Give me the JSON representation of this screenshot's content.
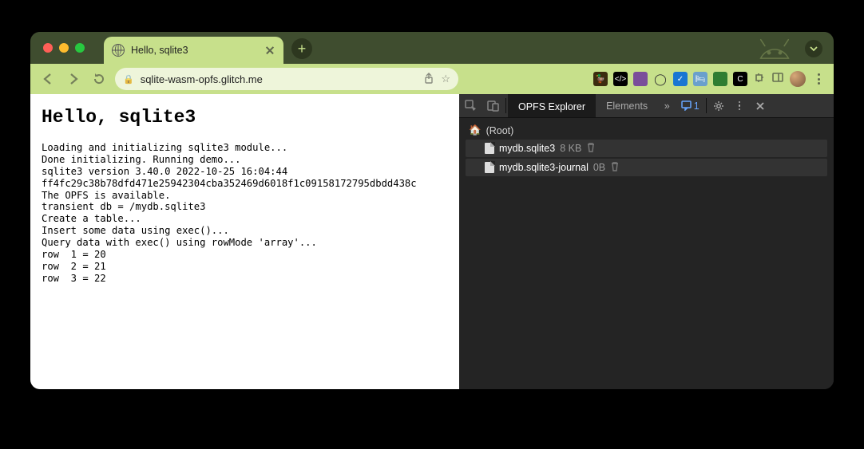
{
  "browser": {
    "tab_title": "Hello, sqlite3",
    "url": "sqlite-wasm-opfs.glitch.me"
  },
  "page": {
    "heading": "Hello, sqlite3",
    "log_lines": [
      "Loading and initializing sqlite3 module...",
      "Done initializing. Running demo...",
      "sqlite3 version 3.40.0 2022-10-25 16:04:44",
      "ff4fc29c38b78dfd471e25942304cba352469d6018f1c09158172795dbdd438c",
      "The OPFS is available.",
      "transient db = /mydb.sqlite3",
      "Create a table...",
      "Insert some data using exec()...",
      "Query data with exec() using rowMode 'array'...",
      "row  1 = 20",
      "row  2 = 21",
      "row  3 = 22"
    ]
  },
  "devtools": {
    "tabs": {
      "active": "OPFS Explorer",
      "next": "Elements"
    },
    "message_count": "1",
    "tree": {
      "root_label": "(Root)",
      "files": [
        {
          "name": "mydb.sqlite3",
          "size": "8 KB"
        },
        {
          "name": "mydb.sqlite3-journal",
          "size": "0B"
        }
      ]
    }
  },
  "extensions": [
    {
      "name": "ext-duckduckgo",
      "bg": "#3b2c0f",
      "glyph": "🦆"
    },
    {
      "name": "ext-devtools-mode",
      "bg": "#000",
      "glyph": "</>"
    },
    {
      "name": "ext-purple",
      "bg": "#7a4d9a",
      "glyph": ""
    },
    {
      "name": "ext-circle",
      "bg": "transparent",
      "glyph": "◯"
    },
    {
      "name": "ext-blue-check",
      "bg": "#1976d2",
      "glyph": "✓"
    },
    {
      "name": "ext-hotel",
      "bg": "#6aa0cc",
      "glyph": "🛏"
    },
    {
      "name": "ext-green",
      "bg": "#2e7d32",
      "glyph": ""
    },
    {
      "name": "ext-black-c",
      "bg": "#000",
      "glyph": "C"
    }
  ]
}
